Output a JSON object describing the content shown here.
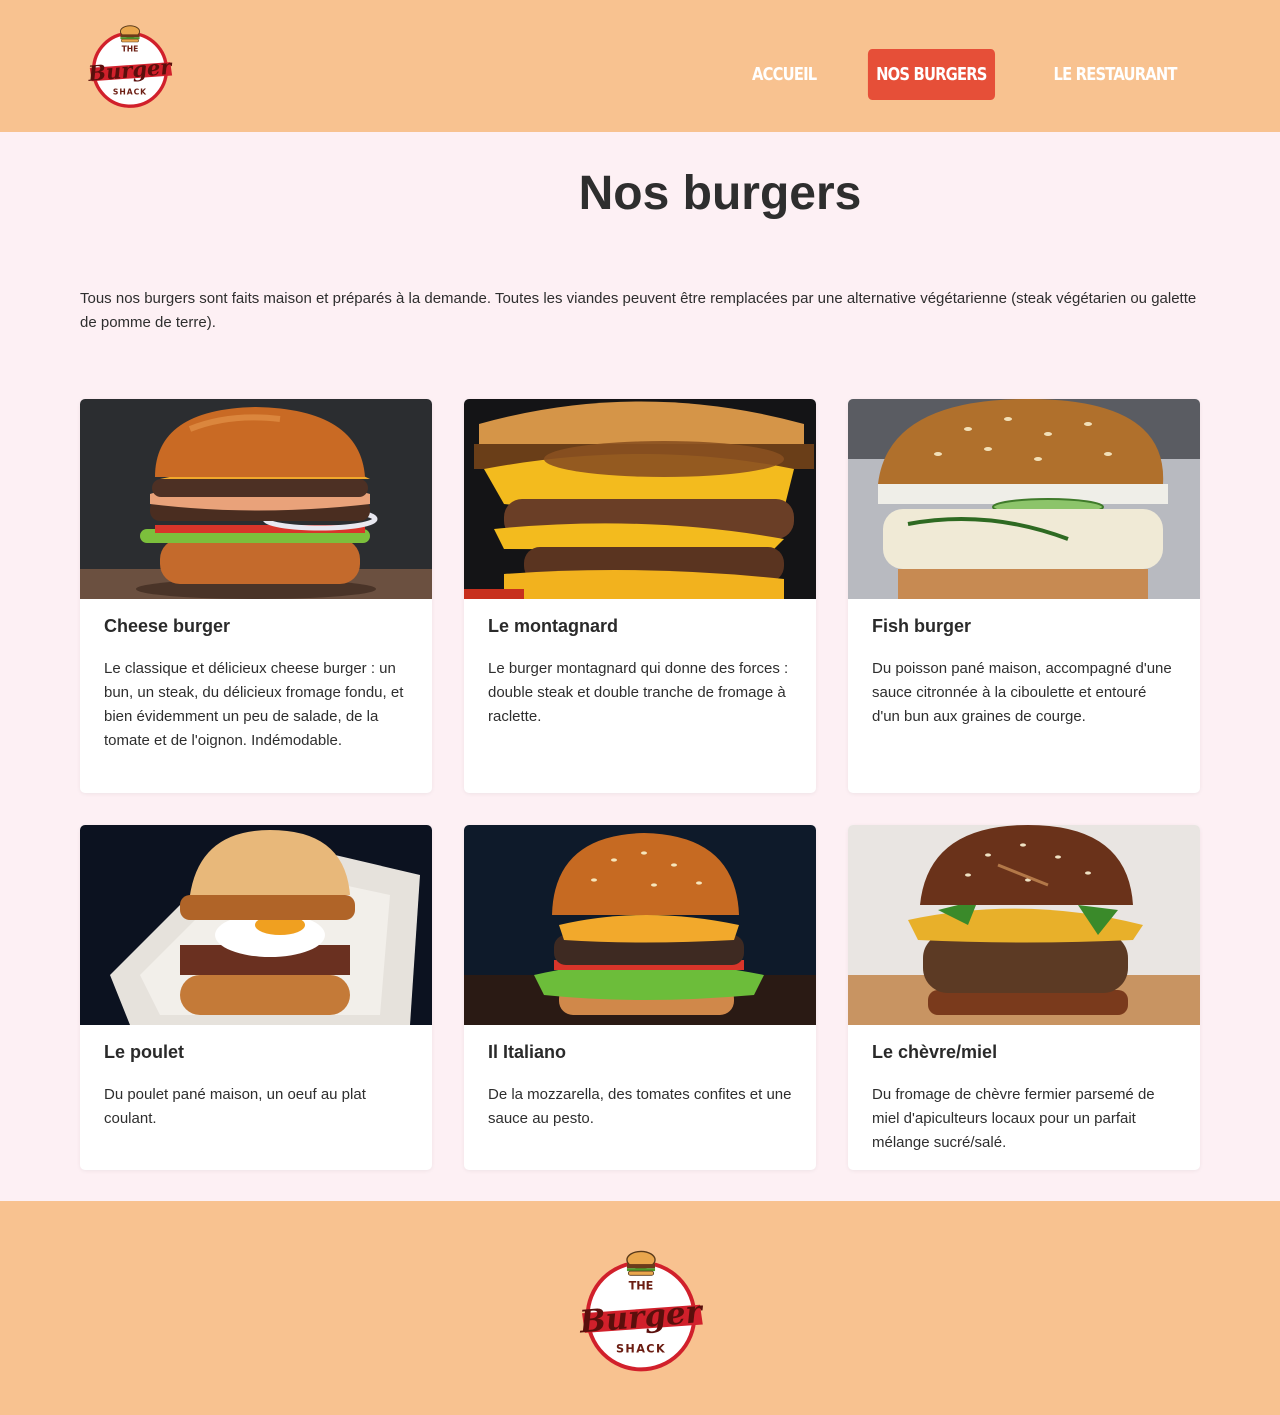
{
  "header": {
    "logo": {
      "line1": "THE",
      "line2": "Burger",
      "line3": "SHACK"
    },
    "nav": [
      {
        "label": "Accueil",
        "active": false
      },
      {
        "label": "Nos burgers",
        "active": true
      },
      {
        "label": "Le restaurant",
        "active": false
      }
    ]
  },
  "main": {
    "title": "Nos burgers",
    "intro": "Tous nos burgers sont faits maison et préparés à la demande. Toutes les viandes peuvent être remplacées par une alternative végétarienne (steak végétarien ou galette de pomme de terre).",
    "burgers": [
      {
        "name": "Cheese burger",
        "description": "Le classique et délicieux cheese burger : un bun, un steak, du délicieux fromage fondu, et bien évidemment un peu de salade, de la tomate et de l'oignon. Indémodable.",
        "image": "cheese-burger-photo"
      },
      {
        "name": "Le montagnard",
        "description": "Le burger montagnard qui donne des forces : double steak et double tranche de fromage à raclette.",
        "image": "montagnard-burger-photo"
      },
      {
        "name": "Fish burger",
        "description": "Du poisson pané maison, accompagné d'une sauce citronnée à la ciboulette et entouré d'un bun aux graines de courge.",
        "image": "fish-burger-photo"
      },
      {
        "name": "Le poulet",
        "description": "Du poulet pané maison, un oeuf au plat coulant.",
        "image": "chicken-burger-photo"
      },
      {
        "name": "Il Italiano",
        "description": "De la mozzarella, des tomates confites et une sauce au pesto.",
        "image": "italian-burger-photo"
      },
      {
        "name": "Le chèvre/miel",
        "description": "Du fromage de chèvre fermier parsemé de miel d'apiculteurs locaux pour un parfait mélange sucré/salé.",
        "image": "goat-honey-burger-photo"
      }
    ]
  },
  "footer": {
    "logo": {
      "line1": "THE",
      "line2": "Burger",
      "line3": "SHACK"
    }
  },
  "colors": {
    "header_bg": "#f8c290",
    "page_bg": "#fdf0f4",
    "accent": "#e64f38",
    "logo_red": "#d1202b",
    "logo_dark": "#7a1412"
  }
}
